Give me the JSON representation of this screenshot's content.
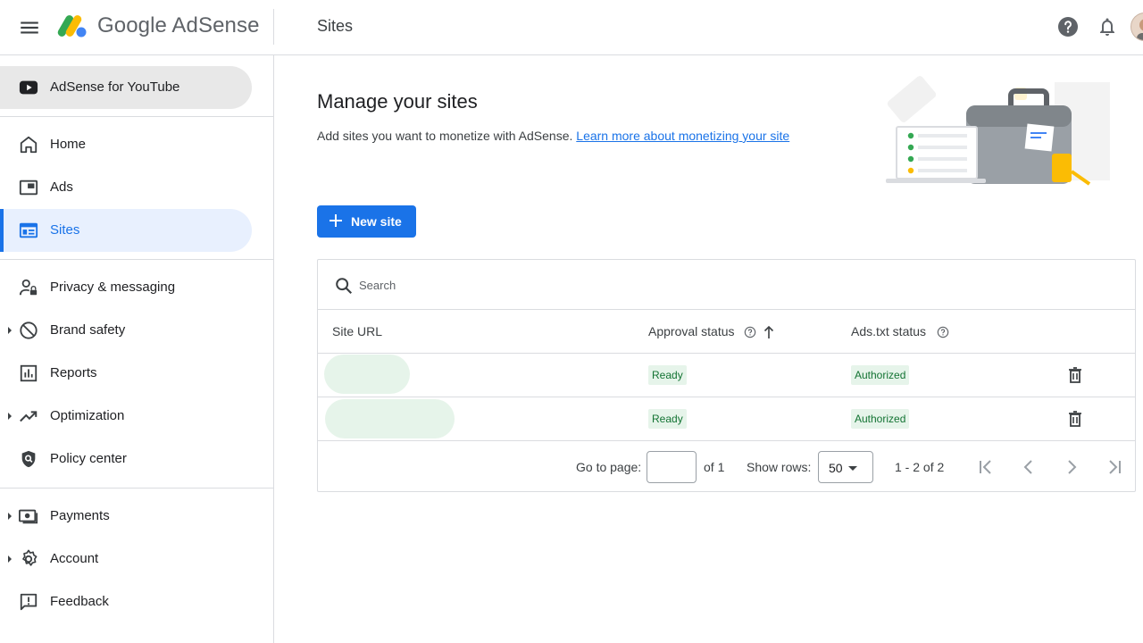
{
  "app": {
    "brand": "Google AdSense",
    "page_title": "Sites"
  },
  "sidebar": {
    "items": [
      {
        "label": "AdSense for YouTube",
        "icon": "youtube-icon"
      },
      {
        "label": "Home",
        "icon": "home-icon"
      },
      {
        "label": "Ads",
        "icon": "ads-icon"
      },
      {
        "label": "Sites",
        "icon": "sites-icon",
        "active": true
      },
      {
        "label": "Privacy & messaging",
        "icon": "privacy-icon"
      },
      {
        "label": "Brand safety",
        "icon": "block-icon",
        "expandable": true
      },
      {
        "label": "Reports",
        "icon": "bar-chart-icon"
      },
      {
        "label": "Optimization",
        "icon": "trending-up-icon",
        "expandable": true
      },
      {
        "label": "Policy center",
        "icon": "policy-shield-icon"
      },
      {
        "label": "Payments",
        "icon": "payments-icon",
        "expandable": true
      },
      {
        "label": "Account",
        "icon": "gear-icon",
        "expandable": true
      },
      {
        "label": "Feedback",
        "icon": "feedback-icon"
      }
    ]
  },
  "main": {
    "heading": "Manage your sites",
    "description": "Add sites you want to monetize with AdSense.",
    "learn_more_link": "Learn more about monetizing your site",
    "new_site_button": "New site"
  },
  "table": {
    "search_placeholder": "Search",
    "columns": {
      "site_url": "Site URL",
      "approval_status": "Approval status",
      "ads_txt_status": "Ads.txt status"
    },
    "rows": [
      {
        "approval": "Ready",
        "ads_txt": "Authorized"
      },
      {
        "approval": "Ready",
        "ads_txt": "Authorized"
      }
    ],
    "footer": {
      "go_to_page_label": "Go to page:",
      "of_pages": "of 1",
      "show_rows_label": "Show rows:",
      "rows_per_page": "50",
      "range": "1 - 2 of 2"
    }
  },
  "colors": {
    "accent": "#1a73e8",
    "status_bg": "#e6f4ea",
    "status_text": "#137333"
  }
}
